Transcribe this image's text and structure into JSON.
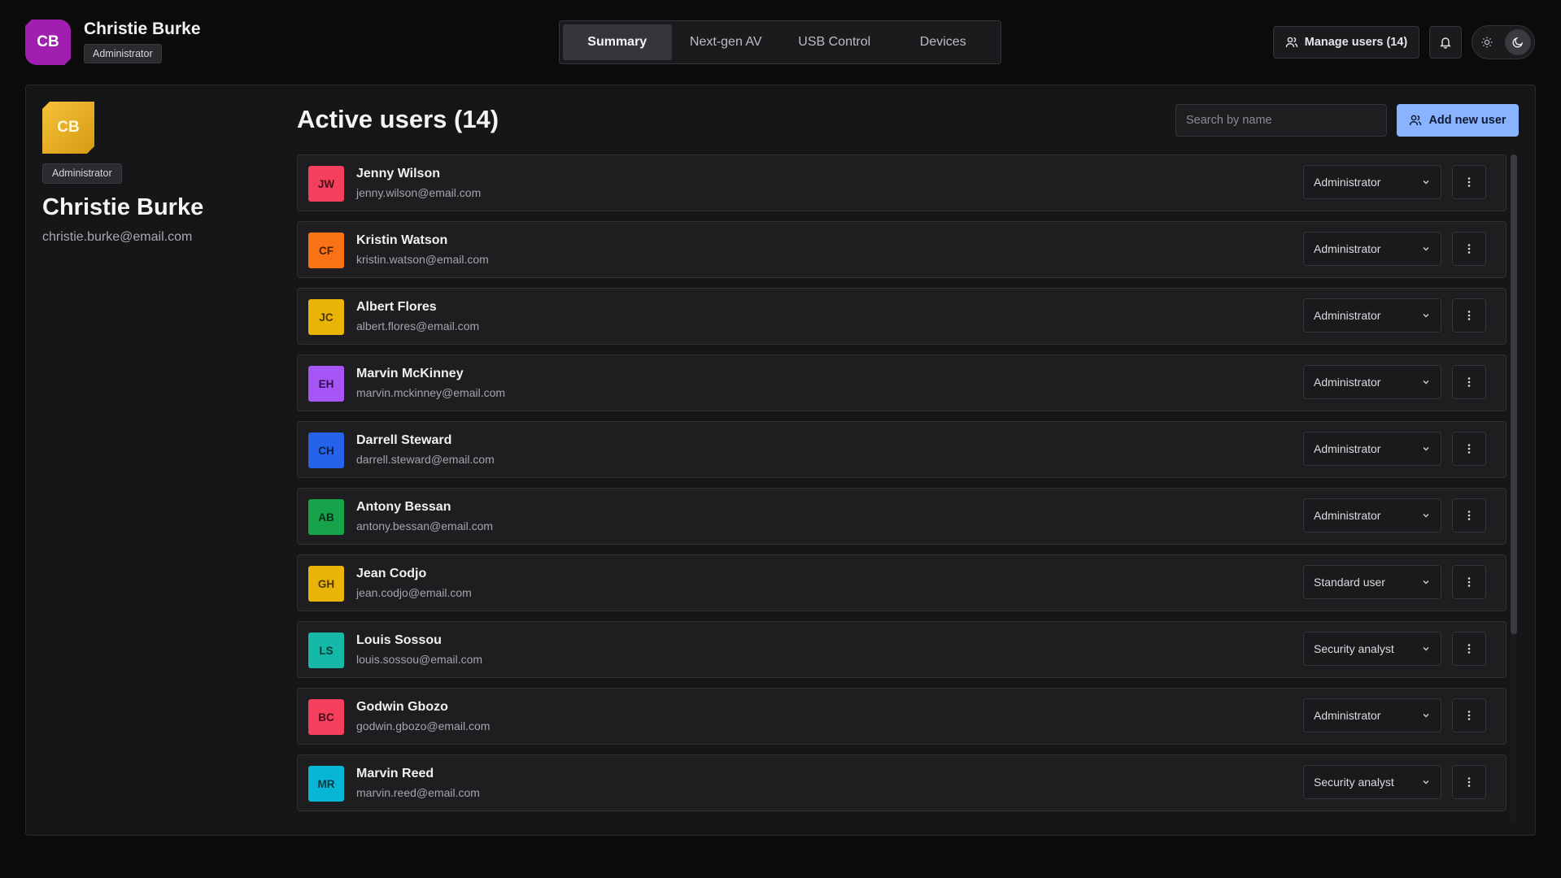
{
  "header": {
    "user_initials": "CB",
    "user_name": "Christie Burke",
    "user_role": "Administrator",
    "tabs": [
      {
        "label": "Summary",
        "active": true
      },
      {
        "label": "Next-gen AV",
        "active": false
      },
      {
        "label": "USB Control",
        "active": false
      },
      {
        "label": "Devices",
        "active": false
      }
    ],
    "manage_users_label": "Manage users (14)"
  },
  "profile": {
    "initials": "CB",
    "role": "Administrator",
    "name": "Christie Burke",
    "email": "christie.burke@email.com"
  },
  "users_list": {
    "title": "Active users (14)",
    "search_placeholder": "Search by name",
    "add_button_label": "Add new user",
    "users": [
      {
        "initials": "JW",
        "name": "Jenny Wilson",
        "email": "jenny.wilson@email.com",
        "role": "Administrator",
        "color": "#f43f5e",
        "text_color": "#4a0d18"
      },
      {
        "initials": "CF",
        "name": "Kristin Watson",
        "email": "kristin.watson@email.com",
        "role": "Administrator",
        "color": "#f97316",
        "text_color": "#4a1f05"
      },
      {
        "initials": "JC",
        "name": "Albert Flores",
        "email": "albert.flores@email.com",
        "role": "Administrator",
        "color": "#eab308",
        "text_color": "#4a3704"
      },
      {
        "initials": "EH",
        "name": "Marvin McKinney",
        "email": "marvin.mckinney@email.com",
        "role": "Administrator",
        "color": "#a855f7",
        "text_color": "#2f0e4d"
      },
      {
        "initials": "CH",
        "name": "Darrell Steward",
        "email": "darrell.steward@email.com",
        "role": "Administrator",
        "color": "#2563eb",
        "text_color": "#0b1d48"
      },
      {
        "initials": "AB",
        "name": "Antony Bessan",
        "email": "antony.bessan@email.com",
        "role": "Administrator",
        "color": "#16a34a",
        "text_color": "#05301a"
      },
      {
        "initials": "GH",
        "name": "Jean Codjo",
        "email": "jean.codjo@email.com",
        "role": "Standard user",
        "color": "#eab308",
        "text_color": "#4a3704"
      },
      {
        "initials": "LS",
        "name": "Louis Sossou",
        "email": "louis.sossou@email.com",
        "role": "Security analyst",
        "color": "#14b8a6",
        "text_color": "#063a34"
      },
      {
        "initials": "BC",
        "name": "Godwin Gbozo",
        "email": "godwin.gbozo@email.com",
        "role": "Administrator",
        "color": "#f43f5e",
        "text_color": "#4a0d18"
      },
      {
        "initials": "MR",
        "name": "Marvin Reed",
        "email": "marvin.reed@email.com",
        "role": "Security analyst",
        "color": "#06b6d4",
        "text_color": "#043844"
      }
    ]
  },
  "colors": {
    "accent": "#8ab3ff",
    "background": "#0b0b0c",
    "panel": "#161618"
  }
}
